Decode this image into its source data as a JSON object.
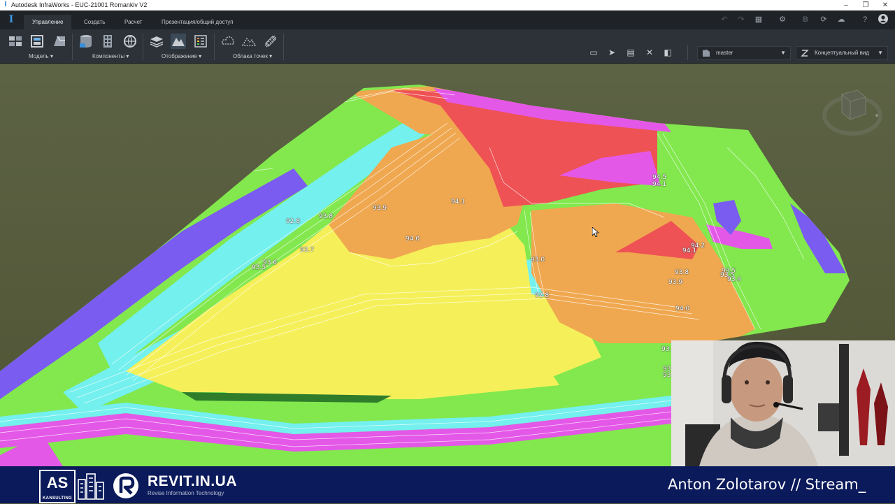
{
  "window": {
    "title": "Autodesk InfraWorks - EUC-21001 Romankiv V2",
    "app_logo": "I"
  },
  "menu": {
    "tabs": [
      "Управление",
      "Создать",
      "Расчет",
      "Презентация/общий доступ"
    ],
    "active_tab": "Управление"
  },
  "ribbon": {
    "groups": [
      {
        "label": "Модель ▾"
      },
      {
        "label": "Компоненты ▾"
      },
      {
        "label": "Отображение ▾"
      },
      {
        "label": "Облака точек ▾"
      }
    ],
    "proposal_dropdown": "master",
    "style_dropdown": "Концептуальный вид"
  },
  "viewport": {
    "elevation_labels": [
      {
        "text": "93.9"
      },
      {
        "text": "94.1"
      },
      {
        "text": "94.0"
      },
      {
        "text": "93.8"
      },
      {
        "text": "92.8"
      },
      {
        "text": "93.7"
      },
      {
        "text": "93.6"
      },
      {
        "text": "93.5"
      },
      {
        "text": "93.0"
      },
      {
        "text": "92.8"
      },
      {
        "text": "93.8"
      },
      {
        "text": "93.9"
      },
      {
        "text": "94.0"
      },
      {
        "text": "94.2"
      },
      {
        "text": "94.1"
      },
      {
        "text": "93.5"
      },
      {
        "text": "94.5"
      },
      {
        "text": "94.1"
      },
      {
        "text": "93.5"
      },
      {
        "text": "93.4"
      },
      {
        "text": "93."
      },
      {
        "text": "93"
      },
      {
        "text": "93"
      }
    ]
  },
  "banner": {
    "as_logo": "AS",
    "as_sub": "KANSULTING",
    "site": "REVIT.IN.UA",
    "site_sub": "Revise Information Technology",
    "streamer": "Anton Zolotarov // Stream_"
  },
  "colors": {
    "banner_bg": "#0b1a5a",
    "ribbon_bg": "#2d3238",
    "menubar_bg": "#1f2226"
  }
}
